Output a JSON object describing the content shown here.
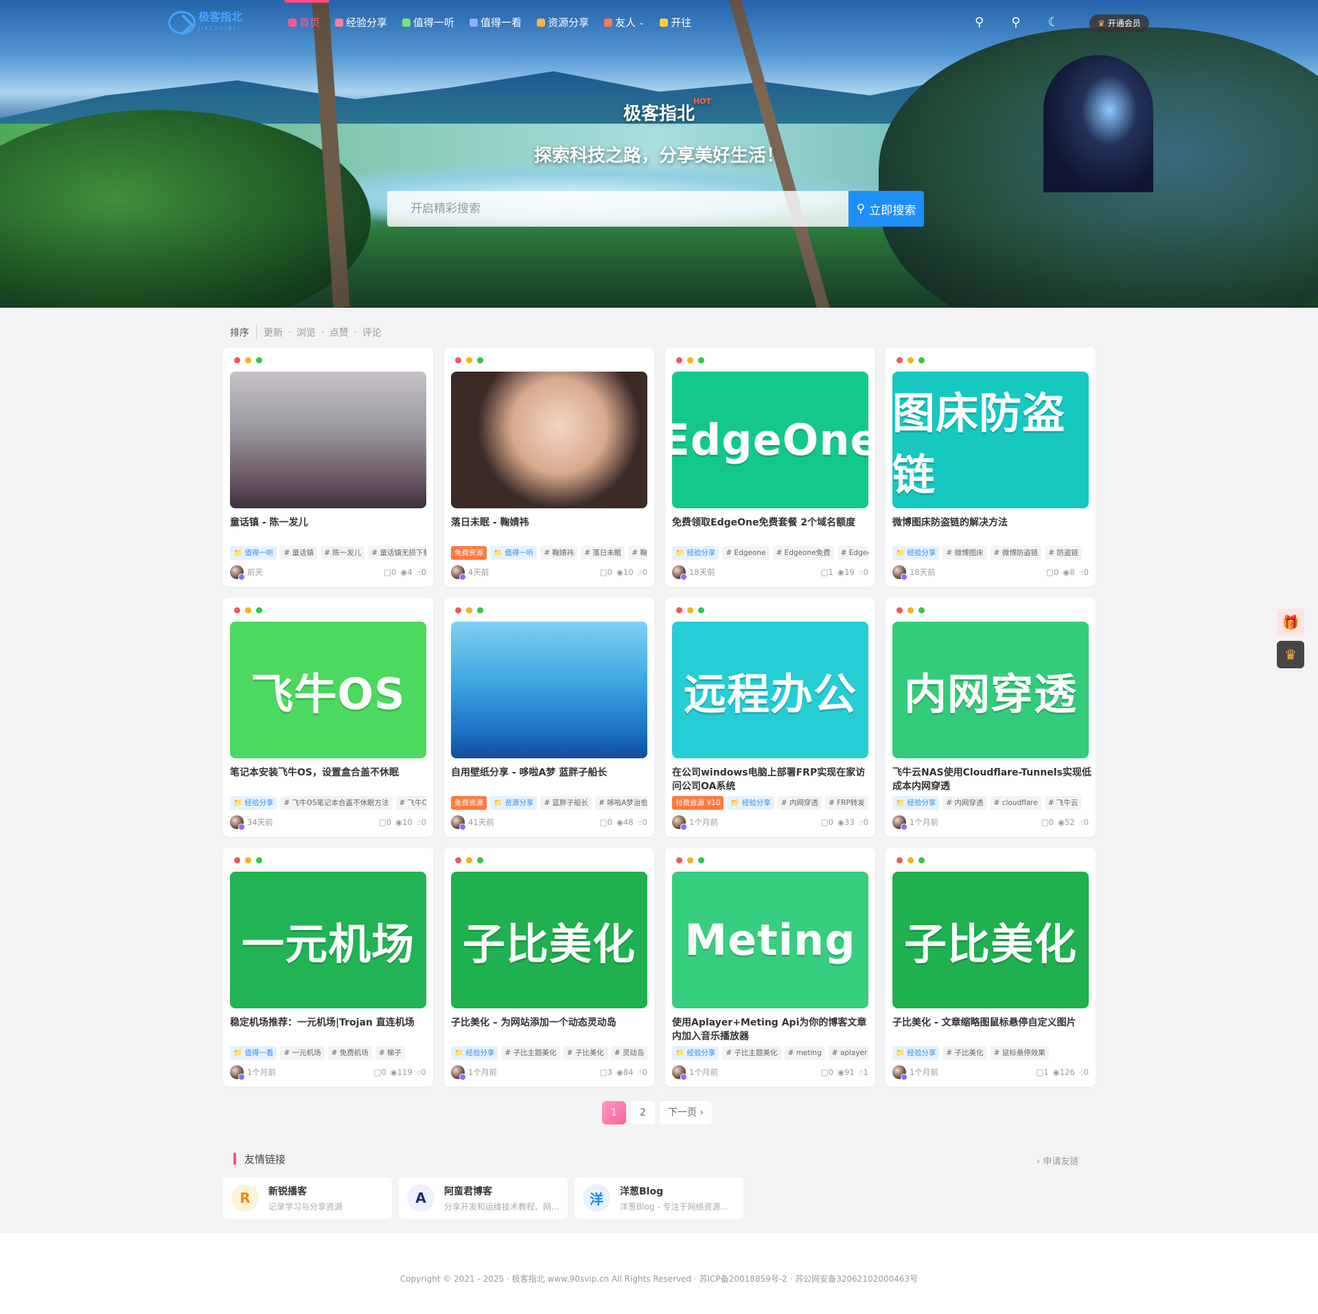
{
  "site": {
    "name": "极客指北",
    "name_en": "JIKEZHIBEI",
    "hot": "HOT",
    "slogan": "探索科技之路，分享美好生活！"
  },
  "nav": {
    "items": [
      {
        "label": "首页",
        "icon": "home-icon",
        "color": "#ff5a8a"
      },
      {
        "label": "经验分享",
        "icon": "book-icon",
        "color": "#ff7aa8"
      },
      {
        "label": "值得一听",
        "icon": "music-icon",
        "color": "#7be27b"
      },
      {
        "label": "值得一看",
        "icon": "video-icon",
        "color": "#8fb0ff"
      },
      {
        "label": "资源分享",
        "icon": "box-icon",
        "color": "#ffb34e"
      },
      {
        "label": "友人",
        "icon": "friends-icon",
        "color": "#ff7a5a"
      },
      {
        "label": "开往",
        "icon": "train-icon",
        "color": "#ffce3a"
      }
    ],
    "vip": "开通会员"
  },
  "search": {
    "placeholder": "开启精彩搜索",
    "button": "立即搜索"
  },
  "sort": {
    "label": "排序",
    "options": [
      "更新",
      "浏览",
      "点赞",
      "评论"
    ]
  },
  "posts": [
    {
      "title": "童话镇 - 陈一发儿",
      "thumb_text": "",
      "thumb_bg": "#6e6a72",
      "tags": [
        [
          "值得一听",
          "cat"
        ],
        [
          "# 童话镇",
          ""
        ],
        [
          "# 陈一发儿",
          ""
        ],
        [
          "# 童话镇无损下载",
          ""
        ]
      ],
      "time": "前天",
      "comments": "0",
      "views": "4",
      "likes": "0"
    },
    {
      "title": "落日未眠 - 鞠婧祎",
      "thumb_text": "",
      "thumb_bg": "#e9c9b4",
      "tags": [
        [
          "免费资源",
          "free"
        ],
        [
          "值得一听",
          "cat"
        ],
        [
          "# 鞠婧祎",
          ""
        ],
        [
          "# 落日未眠",
          ""
        ],
        [
          "# 鞠婧祎无损",
          ""
        ]
      ],
      "time": "4天前",
      "comments": "0",
      "views": "10",
      "likes": "0"
    },
    {
      "title": "免费领取EdgeOne免费套餐 2个域名额度",
      "thumb_text": "EdgeOne",
      "thumb_bg": "#13c98a",
      "tags": [
        [
          "经验分享",
          "cat"
        ],
        [
          "# Edgeone",
          ""
        ],
        [
          "# Edgeone免费",
          ""
        ],
        [
          "# Edgeone免费套餐",
          ""
        ]
      ],
      "time": "18天前",
      "comments": "1",
      "views": "19",
      "likes": "0"
    },
    {
      "title": "微博图床防盗链的解决方法",
      "thumb_text": "图床防盗链",
      "thumb_bg": "#16c8c0",
      "tags": [
        [
          "经验分享",
          "cat"
        ],
        [
          "# 微博图床",
          ""
        ],
        [
          "# 微博防盗链",
          ""
        ],
        [
          "# 防盗链",
          ""
        ]
      ],
      "time": "18天前",
      "comments": "0",
      "views": "8",
      "likes": "0"
    },
    {
      "title": "笔记本安装飞牛OS，设置盒合盖不休眠",
      "thumb_text": "飞牛OS",
      "thumb_bg": "#4bd95f",
      "tags": [
        [
          "经验分享",
          "cat"
        ],
        [
          "# 飞牛OS笔记本合盖不休眠方法",
          ""
        ],
        [
          "# 飞牛OS",
          ""
        ]
      ],
      "time": "34天前",
      "comments": "0",
      "views": "10",
      "likes": "0"
    },
    {
      "title": "自用壁纸分享 - 哆啦A梦 蓝胖子船长",
      "thumb_text": "",
      "thumb_bg": "#57b7ea",
      "tags": [
        [
          "免费资源",
          "free"
        ],
        [
          "资源分享",
          "cat"
        ],
        [
          "# 蓝胖子船长",
          ""
        ],
        [
          "# 哆啦A梦治愈壁纸",
          ""
        ]
      ],
      "time": "41天前",
      "comments": "0",
      "views": "48",
      "likes": "0"
    },
    {
      "title": "在公司windows电脑上部署FRP实现在家访问公司OA系统",
      "thumb_text": "远程办公",
      "thumb_bg": "#25cdd4",
      "tags": [
        [
          "付费资源 ¥10",
          "paid"
        ],
        [
          "经验分享",
          "cat"
        ],
        [
          "# 内网穿透",
          ""
        ],
        [
          "# FRP转发",
          ""
        ]
      ],
      "time": "1个月前",
      "comments": "0",
      "views": "33",
      "likes": "0"
    },
    {
      "title": "飞牛云NAS使用Cloudflare-Tunnels实现低成本内网穿透",
      "thumb_text": "内网穿透",
      "thumb_bg": "#33cc7a",
      "tags": [
        [
          "经验分享",
          "cat"
        ],
        [
          "# 内网穿透",
          ""
        ],
        [
          "# cloudflare",
          ""
        ],
        [
          "# 飞牛云",
          ""
        ]
      ],
      "time": "1个月前",
      "comments": "0",
      "views": "52",
      "likes": "0"
    },
    {
      "title": "稳定机场推荐：一元机场|Trojan 直连机场",
      "thumb_text": "一元机场",
      "thumb_bg": "#20b455",
      "tags": [
        [
          "值得一看",
          "cat"
        ],
        [
          "# 一元机场",
          ""
        ],
        [
          "# 免费机场",
          ""
        ],
        [
          "# 梯子",
          ""
        ]
      ],
      "time": "1个月前",
      "comments": "0",
      "views": "119",
      "likes": "0"
    },
    {
      "title": "子比美化 – 为网站添加一个动态灵动岛",
      "thumb_text": "子比美化",
      "thumb_bg": "#1fb04f",
      "tags": [
        [
          "经验分享",
          "cat"
        ],
        [
          "# 子比主题美化",
          ""
        ],
        [
          "# 子比美化",
          ""
        ],
        [
          "# 灵动岛",
          ""
        ]
      ],
      "time": "1个月前",
      "comments": "3",
      "views": "84",
      "likes": "0"
    },
    {
      "title": "使用Aplayer+Meting Api为你的博客文章内加入音乐播放器",
      "thumb_text": "Meting",
      "thumb_bg": "#36cf7f",
      "tags": [
        [
          "经验分享",
          "cat"
        ],
        [
          "# 子比主题美化",
          ""
        ],
        [
          "# meting",
          ""
        ],
        [
          "# aplayer",
          ""
        ]
      ],
      "time": "1个月前",
      "comments": "0",
      "views": "91",
      "likes": "1"
    },
    {
      "title": "子比美化 - 文章缩略图鼠标悬停自定义图片",
      "thumb_text": "子比美化",
      "thumb_bg": "#1fb04f",
      "tags": [
        [
          "经验分享",
          "cat"
        ],
        [
          "# 子比美化",
          ""
        ],
        [
          "# 鼠标悬停效果",
          ""
        ]
      ],
      "time": "1个月前",
      "comments": "1",
      "views": "126",
      "likes": "0"
    }
  ],
  "pager": {
    "pages": [
      "1",
      "2"
    ],
    "next": "下一页"
  },
  "links": {
    "title": "友情链接",
    "apply": "申请友链",
    "items": [
      {
        "name": "新锐播客",
        "desc": "记录学习与分享资源",
        "logo_text": "R"
      },
      {
        "name": "阿蛮君博客",
        "desc": "分享开发和运维技术教程、网络资源",
        "logo_text": "A"
      },
      {
        "name": "洋葱Blog",
        "desc": "洋葱Blog - 专注于网络资源分享",
        "logo_text": "洋"
      }
    ]
  },
  "footer": {
    "copyright": "Copyright © 2021 - 2025 · 极客指北 www.90svip.cn All Rights Reserved · 苏ICP备20018859号-2 · 苏公网安备32062102000463号"
  }
}
